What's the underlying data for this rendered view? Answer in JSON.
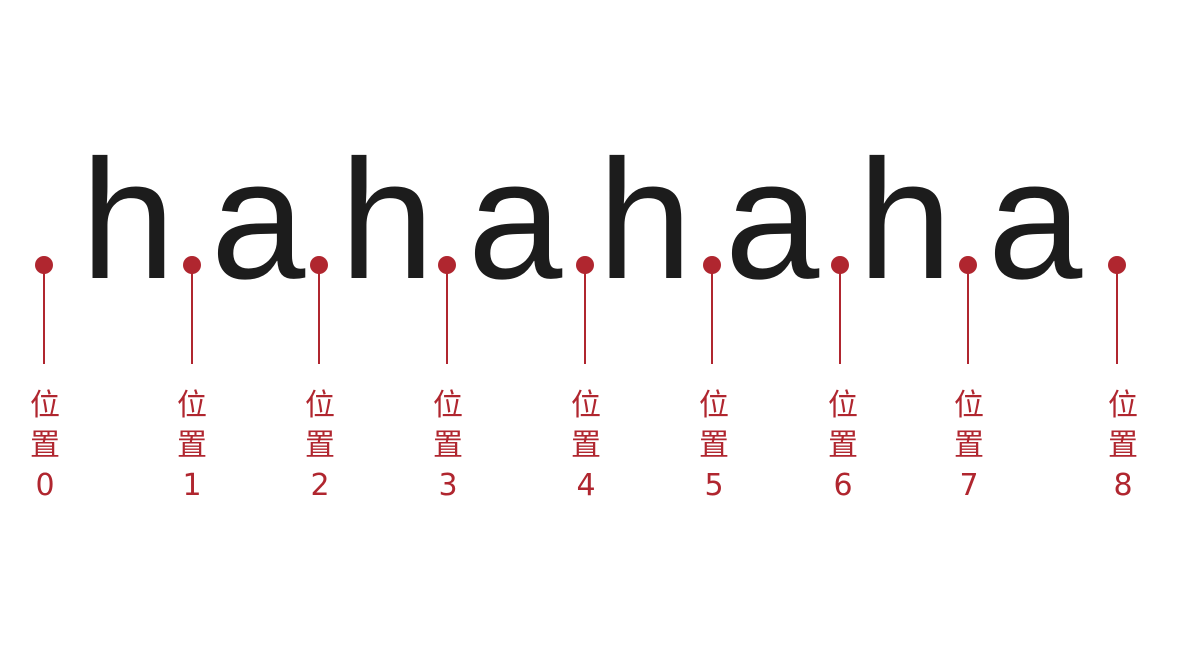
{
  "colors": {
    "accent": "#b0262f",
    "text": "#1c1c1c",
    "background": "#ffffff"
  },
  "letters": [
    "h",
    "a",
    "h",
    "a",
    "h",
    "a",
    "h",
    "a"
  ],
  "position_label_char1": "位",
  "position_label_char2": "置",
  "positions": [
    "0",
    "1",
    "2",
    "3",
    "4",
    "5",
    "6",
    "7",
    "8"
  ]
}
